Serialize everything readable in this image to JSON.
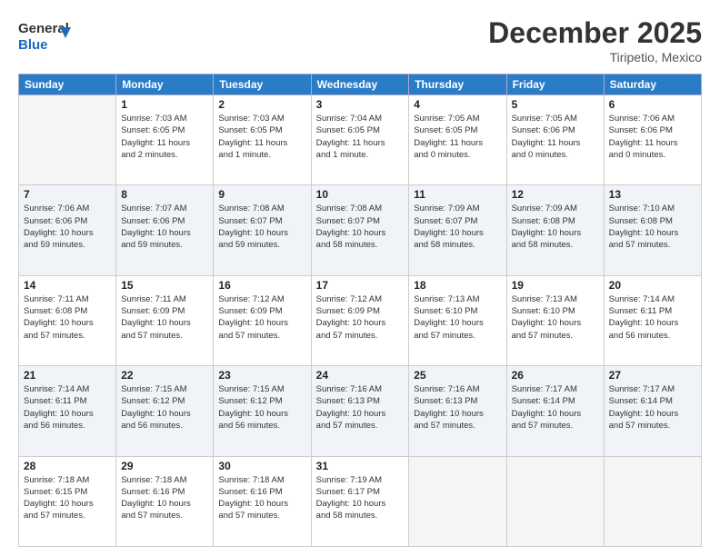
{
  "logo": {
    "line1": "General",
    "line2": "Blue"
  },
  "header": {
    "month_year": "December 2025",
    "location": "Tiripetio, Mexico"
  },
  "weekdays": [
    "Sunday",
    "Monday",
    "Tuesday",
    "Wednesday",
    "Thursday",
    "Friday",
    "Saturday"
  ],
  "weeks": [
    [
      {
        "day": "",
        "info": ""
      },
      {
        "day": "1",
        "info": "Sunrise: 7:03 AM\nSunset: 6:05 PM\nDaylight: 11 hours\nand 2 minutes."
      },
      {
        "day": "2",
        "info": "Sunrise: 7:03 AM\nSunset: 6:05 PM\nDaylight: 11 hours\nand 1 minute."
      },
      {
        "day": "3",
        "info": "Sunrise: 7:04 AM\nSunset: 6:05 PM\nDaylight: 11 hours\nand 1 minute."
      },
      {
        "day": "4",
        "info": "Sunrise: 7:05 AM\nSunset: 6:05 PM\nDaylight: 11 hours\nand 0 minutes."
      },
      {
        "day": "5",
        "info": "Sunrise: 7:05 AM\nSunset: 6:06 PM\nDaylight: 11 hours\nand 0 minutes."
      },
      {
        "day": "6",
        "info": "Sunrise: 7:06 AM\nSunset: 6:06 PM\nDaylight: 11 hours\nand 0 minutes."
      }
    ],
    [
      {
        "day": "7",
        "info": "Sunrise: 7:06 AM\nSunset: 6:06 PM\nDaylight: 10 hours\nand 59 minutes."
      },
      {
        "day": "8",
        "info": "Sunrise: 7:07 AM\nSunset: 6:06 PM\nDaylight: 10 hours\nand 59 minutes."
      },
      {
        "day": "9",
        "info": "Sunrise: 7:08 AM\nSunset: 6:07 PM\nDaylight: 10 hours\nand 59 minutes."
      },
      {
        "day": "10",
        "info": "Sunrise: 7:08 AM\nSunset: 6:07 PM\nDaylight: 10 hours\nand 58 minutes."
      },
      {
        "day": "11",
        "info": "Sunrise: 7:09 AM\nSunset: 6:07 PM\nDaylight: 10 hours\nand 58 minutes."
      },
      {
        "day": "12",
        "info": "Sunrise: 7:09 AM\nSunset: 6:08 PM\nDaylight: 10 hours\nand 58 minutes."
      },
      {
        "day": "13",
        "info": "Sunrise: 7:10 AM\nSunset: 6:08 PM\nDaylight: 10 hours\nand 57 minutes."
      }
    ],
    [
      {
        "day": "14",
        "info": "Sunrise: 7:11 AM\nSunset: 6:08 PM\nDaylight: 10 hours\nand 57 minutes."
      },
      {
        "day": "15",
        "info": "Sunrise: 7:11 AM\nSunset: 6:09 PM\nDaylight: 10 hours\nand 57 minutes."
      },
      {
        "day": "16",
        "info": "Sunrise: 7:12 AM\nSunset: 6:09 PM\nDaylight: 10 hours\nand 57 minutes."
      },
      {
        "day": "17",
        "info": "Sunrise: 7:12 AM\nSunset: 6:09 PM\nDaylight: 10 hours\nand 57 minutes."
      },
      {
        "day": "18",
        "info": "Sunrise: 7:13 AM\nSunset: 6:10 PM\nDaylight: 10 hours\nand 57 minutes."
      },
      {
        "day": "19",
        "info": "Sunrise: 7:13 AM\nSunset: 6:10 PM\nDaylight: 10 hours\nand 57 minutes."
      },
      {
        "day": "20",
        "info": "Sunrise: 7:14 AM\nSunset: 6:11 PM\nDaylight: 10 hours\nand 56 minutes."
      }
    ],
    [
      {
        "day": "21",
        "info": "Sunrise: 7:14 AM\nSunset: 6:11 PM\nDaylight: 10 hours\nand 56 minutes."
      },
      {
        "day": "22",
        "info": "Sunrise: 7:15 AM\nSunset: 6:12 PM\nDaylight: 10 hours\nand 56 minutes."
      },
      {
        "day": "23",
        "info": "Sunrise: 7:15 AM\nSunset: 6:12 PM\nDaylight: 10 hours\nand 56 minutes."
      },
      {
        "day": "24",
        "info": "Sunrise: 7:16 AM\nSunset: 6:13 PM\nDaylight: 10 hours\nand 57 minutes."
      },
      {
        "day": "25",
        "info": "Sunrise: 7:16 AM\nSunset: 6:13 PM\nDaylight: 10 hours\nand 57 minutes."
      },
      {
        "day": "26",
        "info": "Sunrise: 7:17 AM\nSunset: 6:14 PM\nDaylight: 10 hours\nand 57 minutes."
      },
      {
        "day": "27",
        "info": "Sunrise: 7:17 AM\nSunset: 6:14 PM\nDaylight: 10 hours\nand 57 minutes."
      }
    ],
    [
      {
        "day": "28",
        "info": "Sunrise: 7:18 AM\nSunset: 6:15 PM\nDaylight: 10 hours\nand 57 minutes."
      },
      {
        "day": "29",
        "info": "Sunrise: 7:18 AM\nSunset: 6:16 PM\nDaylight: 10 hours\nand 57 minutes."
      },
      {
        "day": "30",
        "info": "Sunrise: 7:18 AM\nSunset: 6:16 PM\nDaylight: 10 hours\nand 57 minutes."
      },
      {
        "day": "31",
        "info": "Sunrise: 7:19 AM\nSunset: 6:17 PM\nDaylight: 10 hours\nand 58 minutes."
      },
      {
        "day": "",
        "info": ""
      },
      {
        "day": "",
        "info": ""
      },
      {
        "day": "",
        "info": ""
      }
    ]
  ]
}
